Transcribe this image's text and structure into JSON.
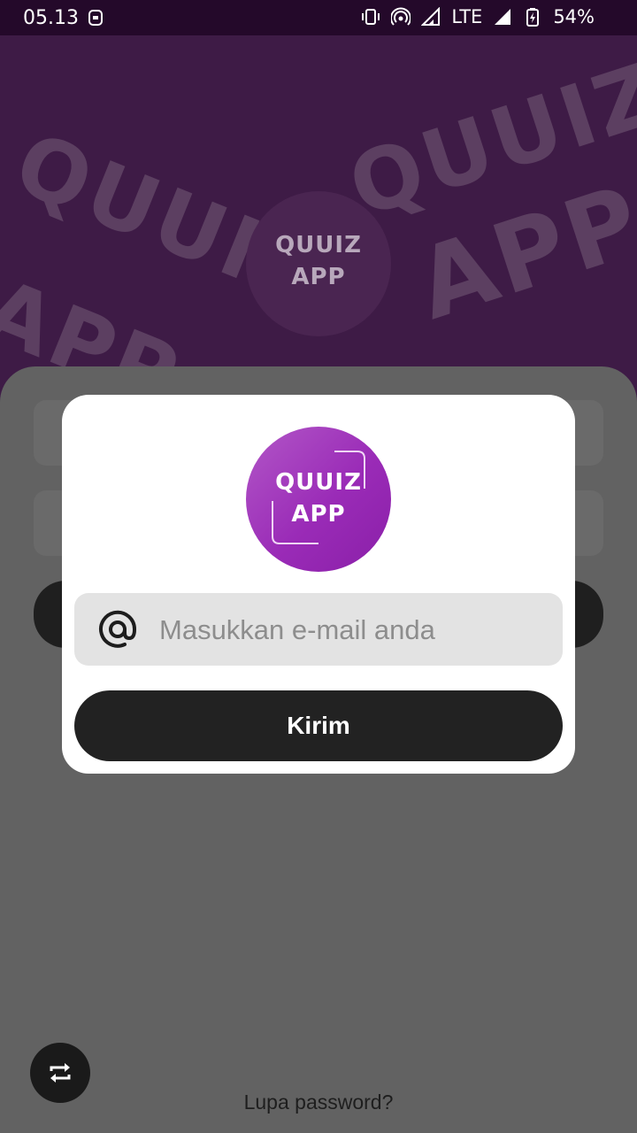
{
  "status_bar": {
    "time": "05.13",
    "network": "LTE",
    "battery": "54%",
    "icons": [
      "notification-icon",
      "vibrate-icon",
      "hotspot-icon",
      "signal-icon",
      "signal-icon",
      "battery-charging-icon"
    ]
  },
  "background": {
    "watermark_text": [
      "QUUIZ",
      "APP",
      "QUUIZ",
      "APP"
    ],
    "logo_text": [
      "QUUIZ",
      "APP"
    ]
  },
  "dialog": {
    "logo_text": [
      "QUUIZ",
      "APP"
    ],
    "email_placeholder": "Masukkan e-mail anda",
    "email_value": "",
    "email_icon": "at-icon",
    "submit_label": "Kirim"
  },
  "bottom": {
    "fab_icon": "repeat-icon",
    "forgot_password": "Lupa password?"
  },
  "colors": {
    "hero": "#3e1b46",
    "logo_gradient_start": "#b257c7",
    "logo_gradient_end": "#8a1fa8",
    "button": "#222222"
  }
}
